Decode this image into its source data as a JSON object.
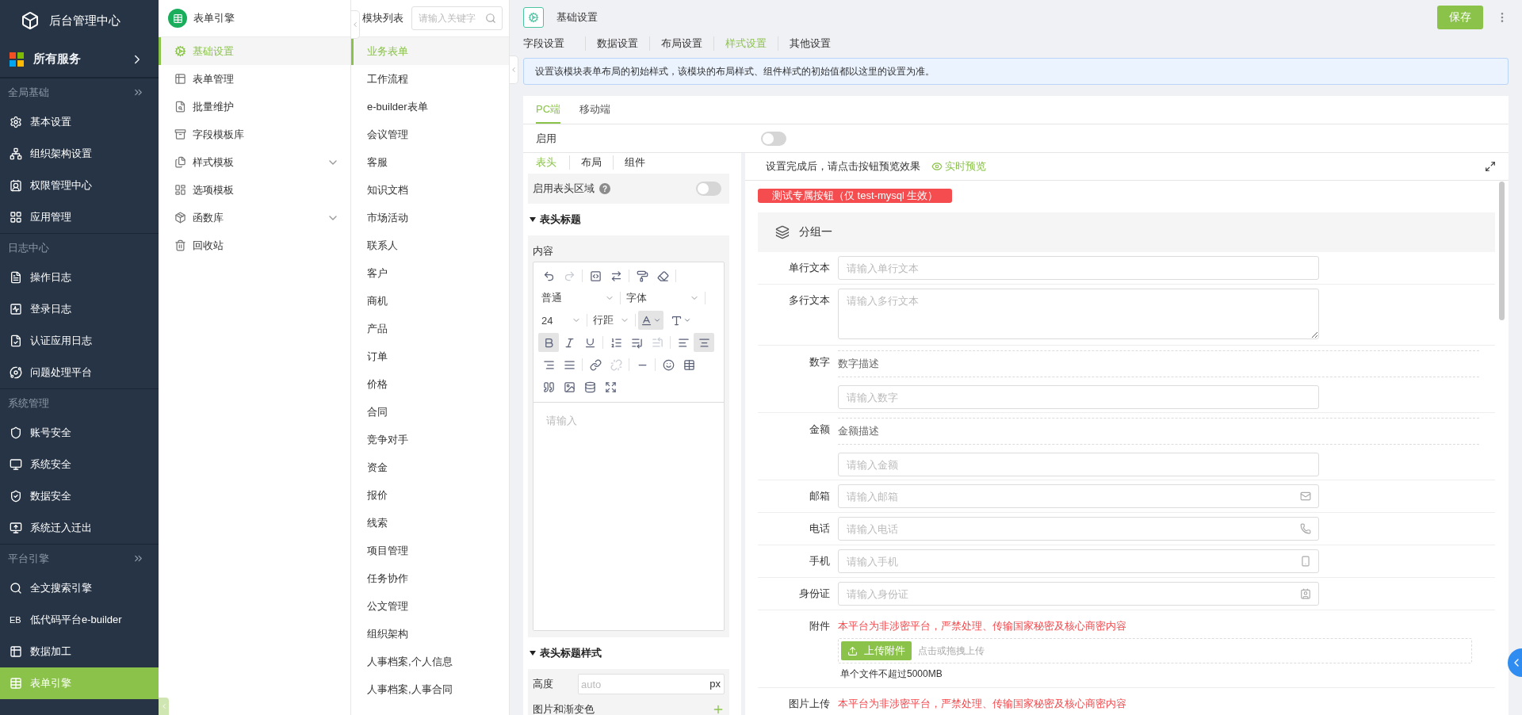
{
  "app_title": "后台管理中心",
  "all_services": "所有服务",
  "nav_sections": [
    {
      "title": "全局基础",
      "expandable": true,
      "items": [
        {
          "label": "基本设置",
          "selected": false
        },
        {
          "label": "组织架构设置",
          "selected": false
        },
        {
          "label": "权限管理中心",
          "selected": false
        },
        {
          "label": "应用管理",
          "selected": false
        }
      ]
    },
    {
      "title": "日志中心",
      "expandable": false,
      "items": [
        {
          "label": "操作日志",
          "selected": false
        },
        {
          "label": "登录日志",
          "selected": false
        },
        {
          "label": "认证应用日志",
          "selected": false
        },
        {
          "label": "问题处理平台",
          "selected": false
        }
      ]
    },
    {
      "title": "系统管理",
      "expandable": false,
      "items": [
        {
          "label": "账号安全",
          "selected": false
        },
        {
          "label": "系统安全",
          "selected": false
        },
        {
          "label": "数据安全",
          "selected": false
        },
        {
          "label": "系统迁入迁出",
          "selected": false
        }
      ]
    },
    {
      "title": "平台引擎",
      "expandable": true,
      "items": [
        {
          "label": "全文搜索引擎",
          "selected": false
        },
        {
          "badge": "EB",
          "label": "低代码平台e-builder",
          "selected": false
        },
        {
          "label": "数据加工",
          "selected": false
        },
        {
          "label": "表单引擎",
          "selected": true
        }
      ]
    }
  ],
  "engine": {
    "title": "表单引擎",
    "items": [
      {
        "label": "基础设置",
        "selected": true
      },
      {
        "label": "表单管理",
        "selected": false
      },
      {
        "label": "批量维护",
        "selected": false
      },
      {
        "label": "字段模板库",
        "selected": false
      },
      {
        "label": "样式模板",
        "selected": false,
        "expanded": false
      },
      {
        "label": "选项模板",
        "selected": false
      },
      {
        "label": "函数库",
        "selected": false,
        "expanded": false
      },
      {
        "label": "回收站",
        "selected": false
      }
    ]
  },
  "modules": {
    "title": "模块列表",
    "search_placeholder": "请输入关键字",
    "items": [
      {
        "label": "业务表单",
        "selected": true
      },
      {
        "label": "工作流程",
        "selected": false
      },
      {
        "label": "e-builder表单",
        "selected": false
      },
      {
        "label": "会议管理",
        "selected": false
      },
      {
        "label": "客服",
        "selected": false
      },
      {
        "label": "知识文档",
        "selected": false
      },
      {
        "label": "市场活动",
        "selected": false
      },
      {
        "label": "联系人",
        "selected": false
      },
      {
        "label": "客户",
        "selected": false
      },
      {
        "label": "商机",
        "selected": false
      },
      {
        "label": "产品",
        "selected": false
      },
      {
        "label": "订单",
        "selected": false
      },
      {
        "label": "价格",
        "selected": false
      },
      {
        "label": "合同",
        "selected": false
      },
      {
        "label": "竞争对手",
        "selected": false
      },
      {
        "label": "资金",
        "selected": false
      },
      {
        "label": "报价",
        "selected": false
      },
      {
        "label": "线索",
        "selected": false
      },
      {
        "label": "项目管理",
        "selected": false
      },
      {
        "label": "任务协作",
        "selected": false
      },
      {
        "label": "公文管理",
        "selected": false
      },
      {
        "label": "组织架构",
        "selected": false
      },
      {
        "label": "人事档案,个人信息",
        "selected": false
      },
      {
        "label": "人事档案,人事合同",
        "selected": false
      }
    ]
  },
  "main": {
    "title": "基础设置",
    "save_button": "保存",
    "tabs": [
      {
        "label": "字段设置",
        "selected": false
      },
      {
        "label": "数据设置",
        "selected": false
      },
      {
        "label": "布局设置",
        "selected": false
      },
      {
        "label": "样式设置",
        "selected": true
      },
      {
        "label": "其他设置",
        "selected": false
      }
    ],
    "notice": "设置该模块表单布局的初始样式，该模块的布局样式、组件样式的初始值都以这里的设置为准。",
    "device_tabs": [
      {
        "label": "PC端",
        "selected": true
      },
      {
        "label": "移动端",
        "selected": false
      }
    ],
    "enable": {
      "label": "启用",
      "on": false
    },
    "editor_panel": {
      "tabs": [
        {
          "label": "表头",
          "selected": true
        },
        {
          "label": "布局",
          "selected": false
        },
        {
          "label": "组件",
          "selected": false
        }
      ],
      "header_area": {
        "label": "启用表头区域",
        "help": "?",
        "on": false
      },
      "title_heading": "表头标题",
      "content_label": "内容",
      "toolbar": {
        "paragraph": "普通",
        "font": "字体",
        "size": "24",
        "line_height": "行距",
        "bold_active": true,
        "align_center_active": true,
        "font_color_active": true
      },
      "editor_placeholder": "请输入",
      "style_heading": "表头标题样式",
      "height": {
        "label": "高度",
        "placeholder": "auto",
        "unit": "px"
      },
      "background_label": "图片和渐变色"
    },
    "preview": {
      "hint": "设置完成后，请点击按钮预览效果",
      "live_preview": "实时预览",
      "test_button": "测试专属按钮（仅 test-mysql 生效）",
      "group": "分组一",
      "fields": [
        {
          "kind": "text",
          "label": "单行文本",
          "placeholder": "请输入单行文本"
        },
        {
          "kind": "textarea",
          "label": "多行文本",
          "placeholder": "请输入多行文本"
        },
        {
          "kind": "number",
          "label": "数字",
          "description": "数字描述",
          "placeholder": "请输入数字"
        },
        {
          "kind": "number",
          "label": "金额",
          "description": "金额描述",
          "placeholder": "请输入金额"
        },
        {
          "kind": "email",
          "label": "邮箱",
          "placeholder": "请输入邮箱"
        },
        {
          "kind": "phone",
          "label": "电话",
          "placeholder": "请输入电话"
        },
        {
          "kind": "mobile",
          "label": "手机",
          "placeholder": "请输入手机"
        },
        {
          "kind": "id_card",
          "label": "身份证",
          "placeholder": "请输入身份证"
        },
        {
          "kind": "upload",
          "label": "附件",
          "warning": "本平台为非涉密平台，严禁处理、传输国家秘密及核心商密内容",
          "button": "上传附件",
          "hint": "点击或拖拽上传",
          "limit": "单个文件不超过5000MB"
        },
        {
          "kind": "image_upload",
          "label": "图片上传",
          "warning": "本平台为非涉密平台，严禁处理、传输国家秘密及核心商密内容"
        }
      ]
    }
  }
}
